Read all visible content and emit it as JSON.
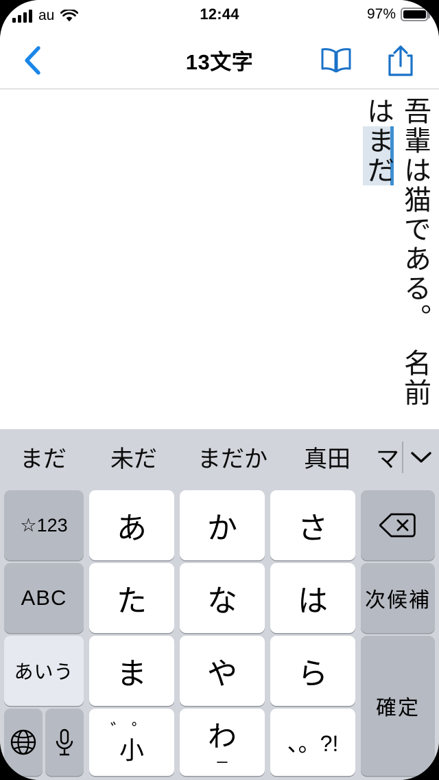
{
  "status_bar": {
    "carrier": "au",
    "time": "12:44",
    "battery_percent": "97%",
    "signal_icon": "cellular-signal-icon",
    "wifi_icon": "wifi-icon",
    "battery_icon": "battery-icon"
  },
  "nav_bar": {
    "back_icon": "chevron-left-icon",
    "title": "13文字",
    "book_icon": "book-icon",
    "share_icon": "share-icon"
  },
  "document": {
    "text_before": "吾輩は猫である。　名前は",
    "composing_text": "まだ",
    "writing_mode": "vertical-rl",
    "composing_highlight_color": "#dce5ee",
    "composing_underline_color": "#3d8fd0"
  },
  "keyboard": {
    "background_color": "#d1d4da",
    "candidates": [
      {
        "label": "まだ"
      },
      {
        "label": "未だ"
      },
      {
        "label": "まだか"
      },
      {
        "label": "真田"
      },
      {
        "label": "マ"
      }
    ],
    "expand_icon": "chevron-down-icon",
    "keys": {
      "symbols_numbers": "☆123",
      "latin_mode": "ABC",
      "kana_mode": "あいう",
      "globe_icon": "globe-icon",
      "mic_icon": "microphone-icon",
      "a_row": "あ",
      "ka_row": "か",
      "sa_row": "さ",
      "ta_row": "た",
      "na_row": "な",
      "ha_row": "は",
      "ma_row": "ま",
      "ya_row": "や",
      "ra_row": "ら",
      "small_marks_top": "゛゜",
      "small_marks_base": "小",
      "wa_base": "わ",
      "wa_under": "_",
      "punctuation": "、。?!",
      "delete_icon": "delete-backward-icon",
      "next_candidate": "次候補",
      "confirm": "確定"
    }
  }
}
